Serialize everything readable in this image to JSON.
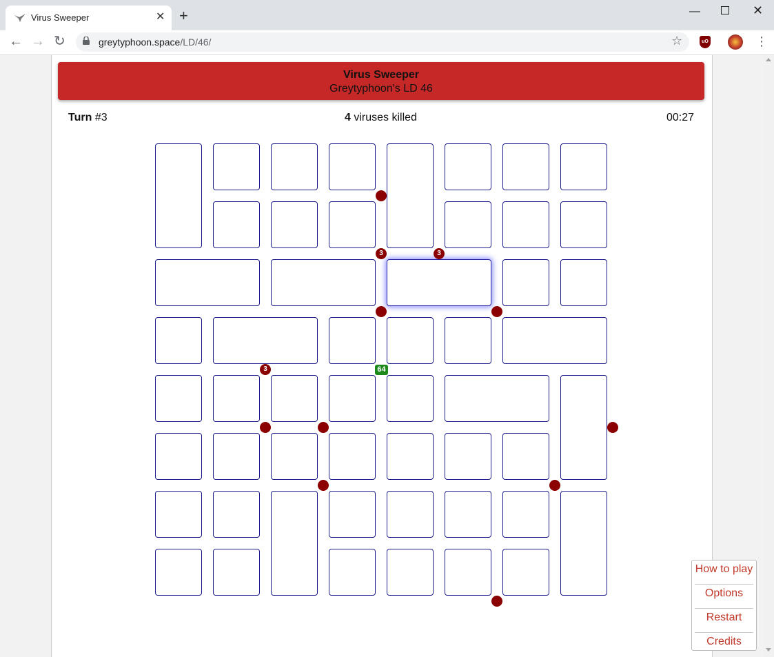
{
  "browser": {
    "tab_title": "Virus Sweeper",
    "url_host": "greytyphoon.space",
    "url_path": "/LD/46/",
    "new_tab_icon": "plus-icon",
    "close_icon": "close-icon"
  },
  "header": {
    "title": "Virus Sweeper",
    "subtitle": "Greytyphoon's LD 46"
  },
  "stats": {
    "turn_label": "Turn",
    "turn_value": "#3",
    "killed_count": "4",
    "killed_label": "viruses killed",
    "timer": "00:27"
  },
  "menu": {
    "how_to_play": "How to play",
    "options": "Options",
    "restart": "Restart",
    "credits": "Credits"
  },
  "board": {
    "columns": 8,
    "rows": 8,
    "cells": [
      {
        "col": 0,
        "row": 0,
        "w": 1,
        "h": 2
      },
      {
        "col": 1,
        "row": 0,
        "w": 1,
        "h": 1
      },
      {
        "col": 2,
        "row": 0,
        "w": 1,
        "h": 1
      },
      {
        "col": 3,
        "row": 0,
        "w": 1,
        "h": 1
      },
      {
        "col": 4,
        "row": 0,
        "w": 1,
        "h": 2
      },
      {
        "col": 5,
        "row": 0,
        "w": 1,
        "h": 1
      },
      {
        "col": 6,
        "row": 0,
        "w": 1,
        "h": 1
      },
      {
        "col": 7,
        "row": 0,
        "w": 1,
        "h": 1
      },
      {
        "col": 1,
        "row": 1,
        "w": 1,
        "h": 1
      },
      {
        "col": 2,
        "row": 1,
        "w": 1,
        "h": 1
      },
      {
        "col": 3,
        "row": 1,
        "w": 1,
        "h": 1
      },
      {
        "col": 5,
        "row": 1,
        "w": 1,
        "h": 1
      },
      {
        "col": 6,
        "row": 1,
        "w": 1,
        "h": 1
      },
      {
        "col": 7,
        "row": 1,
        "w": 1,
        "h": 1
      },
      {
        "col": 0,
        "row": 2,
        "w": 2,
        "h": 1
      },
      {
        "col": 2,
        "row": 2,
        "w": 2,
        "h": 1
      },
      {
        "col": 4,
        "row": 2,
        "w": 2,
        "h": 1,
        "selected": true
      },
      {
        "col": 6,
        "row": 2,
        "w": 1,
        "h": 1
      },
      {
        "col": 7,
        "row": 2,
        "w": 1,
        "h": 1
      },
      {
        "col": 0,
        "row": 3,
        "w": 1,
        "h": 1
      },
      {
        "col": 1,
        "row": 3,
        "w": 2,
        "h": 1
      },
      {
        "col": 3,
        "row": 3,
        "w": 1,
        "h": 1
      },
      {
        "col": 4,
        "row": 3,
        "w": 1,
        "h": 1
      },
      {
        "col": 5,
        "row": 3,
        "w": 1,
        "h": 1
      },
      {
        "col": 6,
        "row": 3,
        "w": 2,
        "h": 1
      },
      {
        "col": 0,
        "row": 4,
        "w": 1,
        "h": 1
      },
      {
        "col": 1,
        "row": 4,
        "w": 1,
        "h": 1
      },
      {
        "col": 2,
        "row": 4,
        "w": 1,
        "h": 1
      },
      {
        "col": 3,
        "row": 4,
        "w": 1,
        "h": 1
      },
      {
        "col": 4,
        "row": 4,
        "w": 1,
        "h": 1
      },
      {
        "col": 5,
        "row": 4,
        "w": 2,
        "h": 1
      },
      {
        "col": 7,
        "row": 4,
        "w": 1,
        "h": 2
      },
      {
        "col": 0,
        "row": 5,
        "w": 1,
        "h": 1
      },
      {
        "col": 1,
        "row": 5,
        "w": 1,
        "h": 1
      },
      {
        "col": 2,
        "row": 5,
        "w": 1,
        "h": 1
      },
      {
        "col": 3,
        "row": 5,
        "w": 1,
        "h": 1
      },
      {
        "col": 4,
        "row": 5,
        "w": 1,
        "h": 1
      },
      {
        "col": 5,
        "row": 5,
        "w": 1,
        "h": 1
      },
      {
        "col": 6,
        "row": 5,
        "w": 1,
        "h": 1
      },
      {
        "col": 0,
        "row": 6,
        "w": 1,
        "h": 1
      },
      {
        "col": 1,
        "row": 6,
        "w": 1,
        "h": 1
      },
      {
        "col": 2,
        "row": 6,
        "w": 1,
        "h": 2
      },
      {
        "col": 3,
        "row": 6,
        "w": 1,
        "h": 1
      },
      {
        "col": 4,
        "row": 6,
        "w": 1,
        "h": 1
      },
      {
        "col": 5,
        "row": 6,
        "w": 1,
        "h": 1
      },
      {
        "col": 6,
        "row": 6,
        "w": 1,
        "h": 1
      },
      {
        "col": 7,
        "row": 6,
        "w": 1,
        "h": 2
      },
      {
        "col": 0,
        "row": 7,
        "w": 1,
        "h": 1
      },
      {
        "col": 1,
        "row": 7,
        "w": 1,
        "h": 1
      },
      {
        "col": 3,
        "row": 7,
        "w": 1,
        "h": 1
      },
      {
        "col": 4,
        "row": 7,
        "w": 1,
        "h": 1
      },
      {
        "col": 5,
        "row": 7,
        "w": 1,
        "h": 1
      },
      {
        "col": 6,
        "row": 7,
        "w": 1,
        "h": 1
      }
    ],
    "viruses": [
      {
        "gx": 4,
        "gy": 1,
        "label": ""
      },
      {
        "gx": 4,
        "gy": 2,
        "label": "3"
      },
      {
        "gx": 5,
        "gy": 2,
        "label": "3"
      },
      {
        "gx": 4,
        "gy": 3,
        "label": ""
      },
      {
        "gx": 6,
        "gy": 3,
        "label": ""
      },
      {
        "gx": 2,
        "gy": 4,
        "label": "3"
      },
      {
        "gx": 2,
        "gy": 5,
        "label": ""
      },
      {
        "gx": 3,
        "gy": 5,
        "label": ""
      },
      {
        "gx": 8,
        "gy": 5,
        "label": ""
      },
      {
        "gx": 3,
        "gy": 6,
        "label": ""
      },
      {
        "gx": 7,
        "gy": 6,
        "label": ""
      },
      {
        "gx": 6,
        "gy": 8,
        "label": ""
      }
    ],
    "badges": [
      {
        "gx": 4,
        "gy": 4,
        "label": "64"
      }
    ],
    "colors": {
      "cell_border": "#1a1a8a",
      "virus": "#8b0000",
      "badge": "#1b8a1b",
      "header": "#c62828"
    }
  }
}
